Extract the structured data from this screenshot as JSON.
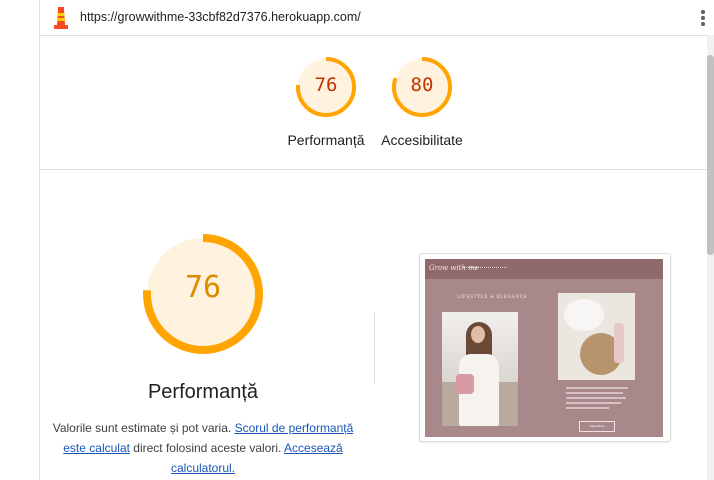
{
  "header": {
    "url": "https://growwithme-33cbf82d7376.herokuapp.com/",
    "logo_icon": "lighthouse-icon",
    "menu_icon": "kebab-menu-icon"
  },
  "summary_gauges": [
    {
      "score": "76",
      "label": "Performanță",
      "fraction": 0.76
    },
    {
      "score": "80",
      "label": "Accesibilitate",
      "fraction": 0.8
    }
  ],
  "performance": {
    "score": "76",
    "fraction": 0.76,
    "title": "Performanță",
    "desc_prefix": "Valorile sunt estimate și pot varia. ",
    "link_score": "Scorul de performanță este calculat",
    "desc_middle": " direct folosind aceste valori. ",
    "link_calculator": "Accesează calculatorul."
  },
  "thumbnail": {
    "brand": "Grow with me",
    "heading": "LIFESTYLE & ELEGANCE",
    "button": "Read More"
  },
  "colors": {
    "gauge_average": "#ffa400",
    "gauge_fill": "#fff3e0",
    "score_text": "#c33300",
    "link": "#1a56b8"
  }
}
